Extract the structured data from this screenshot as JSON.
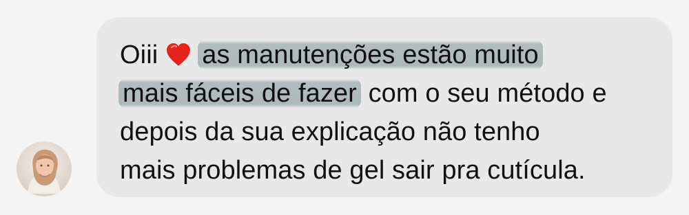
{
  "chat": {
    "message": {
      "line1_prefix": "Oiii",
      "emoji": "red-heart-icon",
      "line1_highlight": "as manutenções estão muito",
      "line2_highlight": "mais fáceis de fazer",
      "line2_rest": " com o seu método e",
      "line3": "depois da sua explicação não tenho",
      "line4": "mais problemas de gel sair pra cutícula."
    },
    "colors": {
      "bubble": "#e8e8e8",
      "highlight": "#96a8aa",
      "background": "#f4f4f4"
    }
  }
}
